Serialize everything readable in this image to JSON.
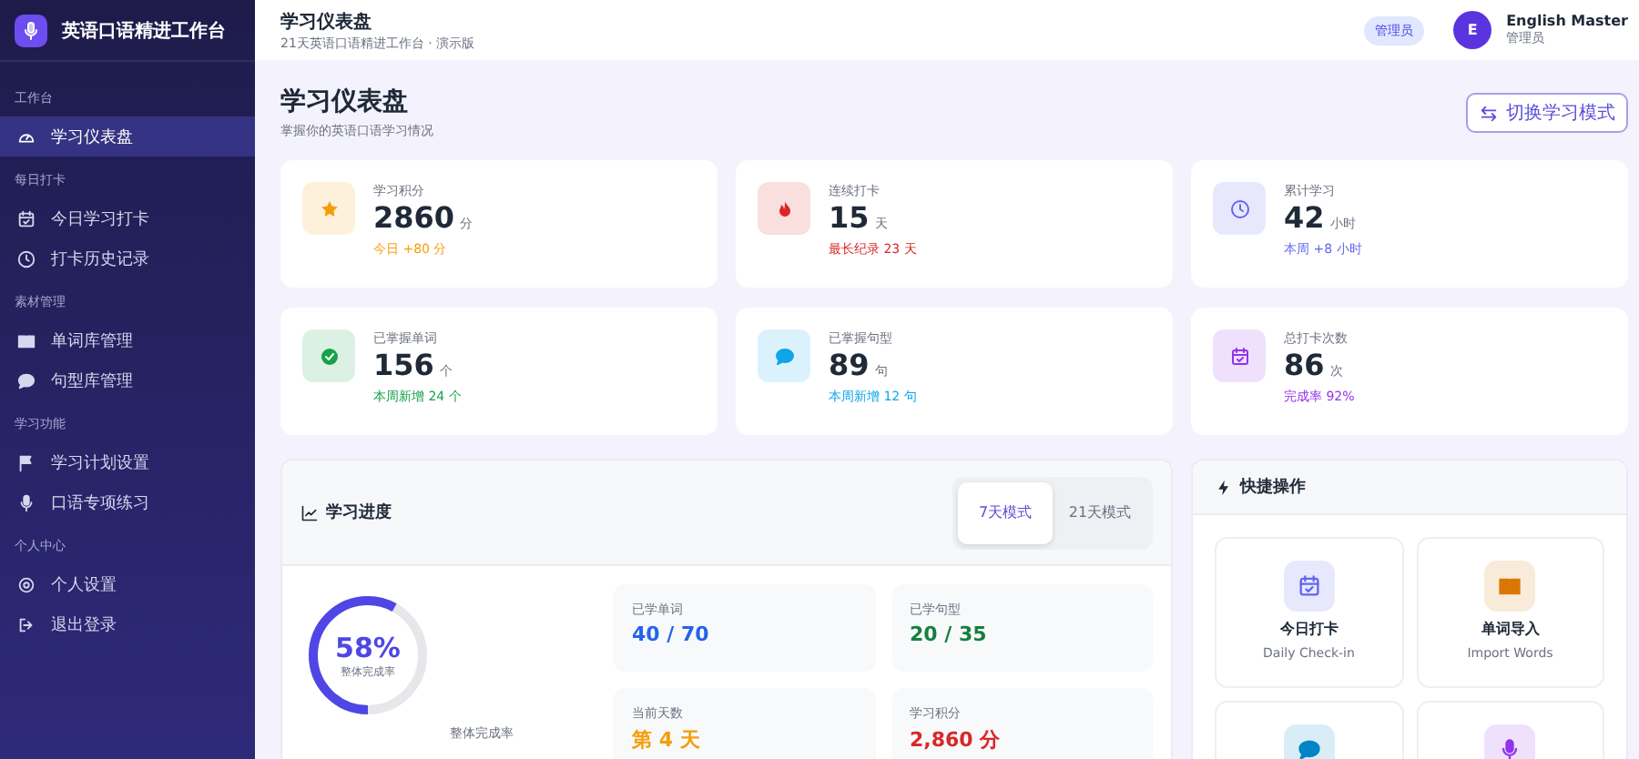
{
  "app": {
    "title": "英语口语精进工作台"
  },
  "sidebar": {
    "sections": [
      {
        "title": "工作台",
        "items": [
          {
            "label": "学习仪表盘",
            "selected": true
          }
        ]
      },
      {
        "title": "每日打卡",
        "items": [
          {
            "label": "今日学习打卡",
            "selected": false
          },
          {
            "label": "打卡历史记录",
            "selected": false
          }
        ]
      },
      {
        "title": "素材管理",
        "items": [
          {
            "label": "单词库管理",
            "selected": false
          },
          {
            "label": "句型库管理",
            "selected": false
          }
        ]
      },
      {
        "title": "学习功能",
        "items": [
          {
            "label": "学习计划设置",
            "selected": false
          },
          {
            "label": "口语专项练习",
            "selected": false
          }
        ]
      },
      {
        "title": "个人中心",
        "items": [
          {
            "label": "个人设置",
            "selected": false
          },
          {
            "label": "退出登录",
            "selected": false
          }
        ]
      }
    ]
  },
  "header": {
    "title": "学习仪表盘",
    "subtitle": "21天英语口语精进工作台 · 演示版",
    "role_badge": "管理员",
    "user": {
      "initial": "E",
      "name": "English Master",
      "role": "管理员"
    }
  },
  "page": {
    "title": "学习仪表盘",
    "subtitle": "掌握你的英语口语学习情况",
    "switch_button": "切换学习模式"
  },
  "stats": [
    {
      "label": "学习积分",
      "value": "2860",
      "unit": "分",
      "note": "今日 +80 分",
      "color": "#f59e0b"
    },
    {
      "label": "连续打卡",
      "value": "15",
      "unit": "天",
      "note": "最长纪录 23 天",
      "color": "#dc2626"
    },
    {
      "label": "累计学习",
      "value": "42",
      "unit": "小时",
      "note": "本周 +8 小时",
      "color": "#6366f1"
    },
    {
      "label": "已掌握单词",
      "value": "156",
      "unit": "个",
      "note": "本周新增 24 个",
      "color": "#16a34a"
    },
    {
      "label": "已掌握句型",
      "value": "89",
      "unit": "句",
      "note": "本周新增 12 句",
      "color": "#0ea5e9"
    },
    {
      "label": "总打卡次数",
      "value": "86",
      "unit": "次",
      "note": "完成率 92%",
      "color": "#9333ea"
    }
  ],
  "progress": {
    "title": "学习进度",
    "tabs": [
      {
        "label": "7天模式",
        "selected": true
      },
      {
        "label": "21天模式",
        "selected": false
      }
    ],
    "ring": {
      "percent": "58%",
      "label": "整体完成率",
      "level": 0.58
    },
    "caption": "整体完成率",
    "tiles": [
      {
        "label": "已学单词",
        "value": "40 / 70",
        "color": "#2563eb"
      },
      {
        "label": "已学句型",
        "value": "20 / 35",
        "color": "#15803d"
      },
      {
        "label": "当前天数",
        "value": "第 4 天",
        "color": "#f59e0b"
      },
      {
        "label": "学习积分",
        "value": "2,860 分",
        "color": "#dc2626"
      }
    ]
  },
  "quick_actions": {
    "title": "快捷操作",
    "items": [
      {
        "title": "今日打卡",
        "subtitle": "Daily Check-in",
        "color": "#6366f1"
      },
      {
        "title": "单词导入",
        "subtitle": "Import Words",
        "color": "#d97706"
      },
      {
        "color": "#0284c7"
      },
      {
        "color": "#9333ea"
      }
    ]
  }
}
